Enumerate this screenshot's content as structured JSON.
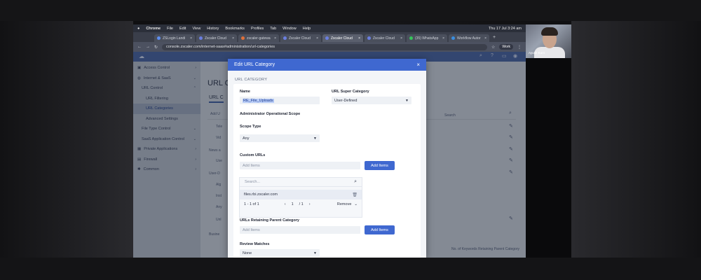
{
  "macbar": {
    "app": "Chrome",
    "menus": [
      "File",
      "Edit",
      "View",
      "History",
      "Bookmarks",
      "Profiles",
      "Tab",
      "Window",
      "Help"
    ],
    "clock": "Thu 17 Jul 3:24 am"
  },
  "browser": {
    "tabs": [
      {
        "label": "ZSLogin Landi",
        "color": "#5e8ef0"
      },
      {
        "label": "Zscaler Cloud",
        "color": "#6a7ee0"
      },
      {
        "label": "zscaler-gatewa",
        "color": "#e0703a"
      },
      {
        "label": "Zscaler Cloud",
        "color": "#6a7ee0"
      },
      {
        "label": "Zscaler Cloud",
        "color": "#6a7ee0"
      },
      {
        "label": "Zscaler Cloud",
        "color": "#6a7ee0"
      },
      {
        "label": "(35) WhatsApp",
        "color": "#36c45a"
      },
      {
        "label": "Workflow Autor",
        "color": "#3a8ee0"
      }
    ],
    "url": "console.zscaler.com/internet-saas#administration/url-categories",
    "profile": "Work"
  },
  "sidebar": {
    "items": [
      {
        "label": "Access Control",
        "level": 0,
        "active": false
      },
      {
        "label": "Internet & SaaS",
        "level": 0,
        "active": false
      },
      {
        "label": "URL Control",
        "level": 1,
        "active": false
      },
      {
        "label": "URL Filtering",
        "level": 2,
        "active": false
      },
      {
        "label": "URL Categories",
        "level": 2,
        "active": true
      },
      {
        "label": "Advanced Settings",
        "level": 2,
        "active": false
      },
      {
        "label": "File Type Control",
        "level": 1,
        "active": false
      },
      {
        "label": "SaaS Application Control",
        "level": 1,
        "active": false
      },
      {
        "label": "Private Applications",
        "level": 0,
        "active": false
      },
      {
        "label": "Firewall",
        "level": 0,
        "active": false
      },
      {
        "label": "Common",
        "level": 0,
        "active": false
      }
    ]
  },
  "background_page": {
    "title": "URL C",
    "tab": "URL C",
    "partial_labels": [
      "Add U",
      "Tele",
      "Vid",
      "News a",
      "Use",
      "User-D",
      "Alg",
      "Inst",
      "Any",
      "Unl",
      "Busine"
    ],
    "search_text": "Search",
    "footer_col": "No. of Keywords Retaining Parent Category"
  },
  "modal": {
    "title": "Edit URL Category",
    "section": "URL CATEGORY",
    "name_label": "Name",
    "name_value": "RE_File_Uploads",
    "super_label": "URL Super Category",
    "super_value": "User-Defined",
    "scope_heading": "Administrator Operational Scope",
    "scope_type_label": "Scope Type",
    "scope_type_value": "Any",
    "custom_urls_label": "Custom URLs",
    "add_items_placeholder": "Add Items",
    "add_items_button": "Add Items",
    "search_placeholder": "Search...",
    "url_entry": "files.rbi.zscaler.com",
    "pager_count": "1 - 1 of 1",
    "pager_current": "1",
    "pager_total": "/ 1",
    "remove_label": "Remove",
    "retaining_label": "URLs Retaining Parent Category",
    "retaining_placeholder": "Add Items",
    "retaining_button": "Add Items",
    "review_label": "Review Matches",
    "review_value": "None"
  },
  "webcam": {
    "name": "Ayush Kant"
  }
}
